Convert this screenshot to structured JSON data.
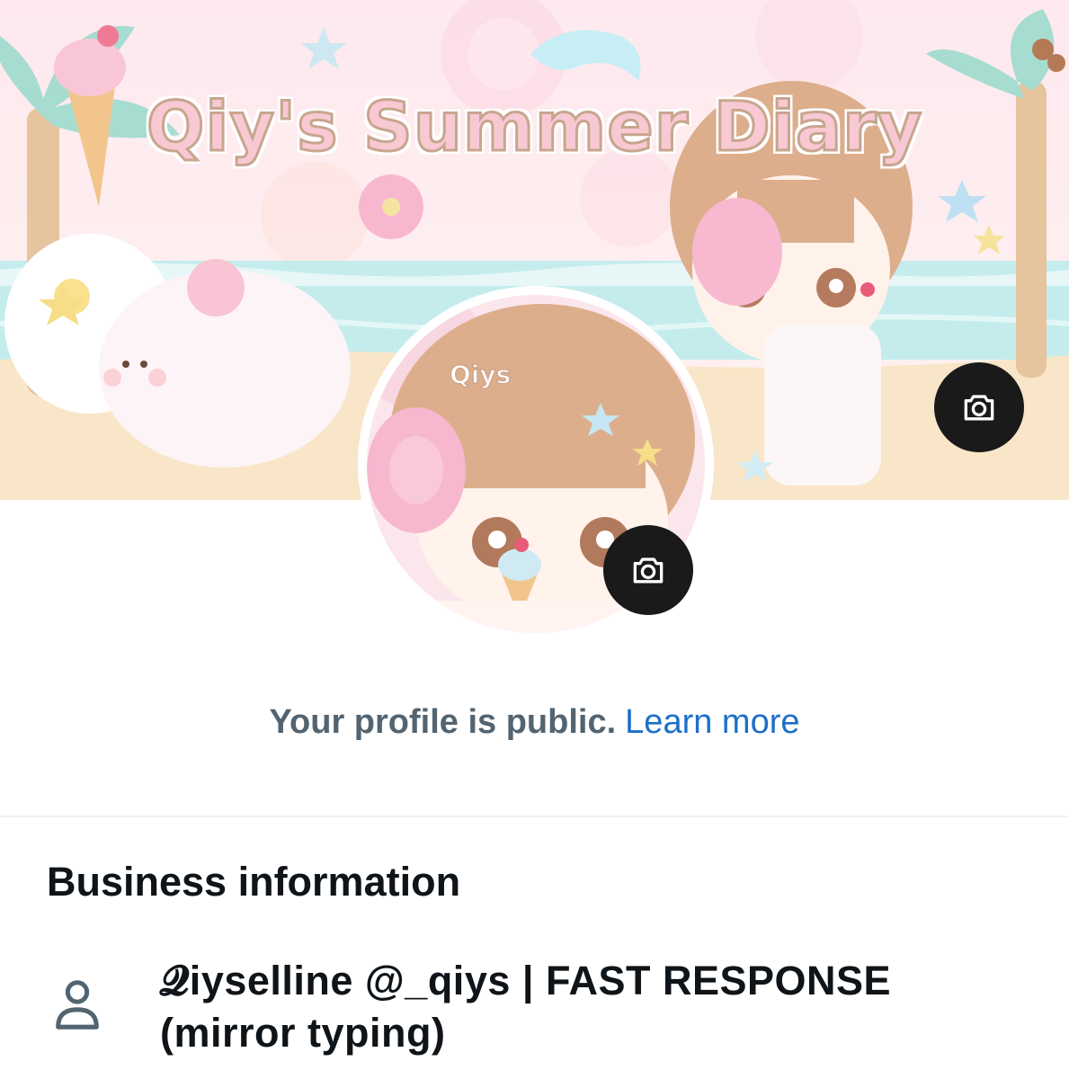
{
  "banner": {
    "title": "Qiy's Summer Diary",
    "colors": {
      "sky": "#fce8ef",
      "sea": "#bfe9ea",
      "sand": "#f9e7c9",
      "title_fill": "#f8c9d3",
      "title_stroke": "#c8a58e"
    }
  },
  "avatar": {
    "label": "Qiys"
  },
  "header_camera": {
    "icon": "camera-icon"
  },
  "avatar_camera": {
    "icon": "camera-icon"
  },
  "profile_status": {
    "text": "Your profile is public.",
    "link": "Learn more",
    "link_color": "#1d6fc9"
  },
  "business": {
    "title": "Business information",
    "name_line1": "𝓠iyselline @_qiys | FAST RESPONSE",
    "name_line2": "(mirror typing)",
    "icon": "person-icon"
  }
}
